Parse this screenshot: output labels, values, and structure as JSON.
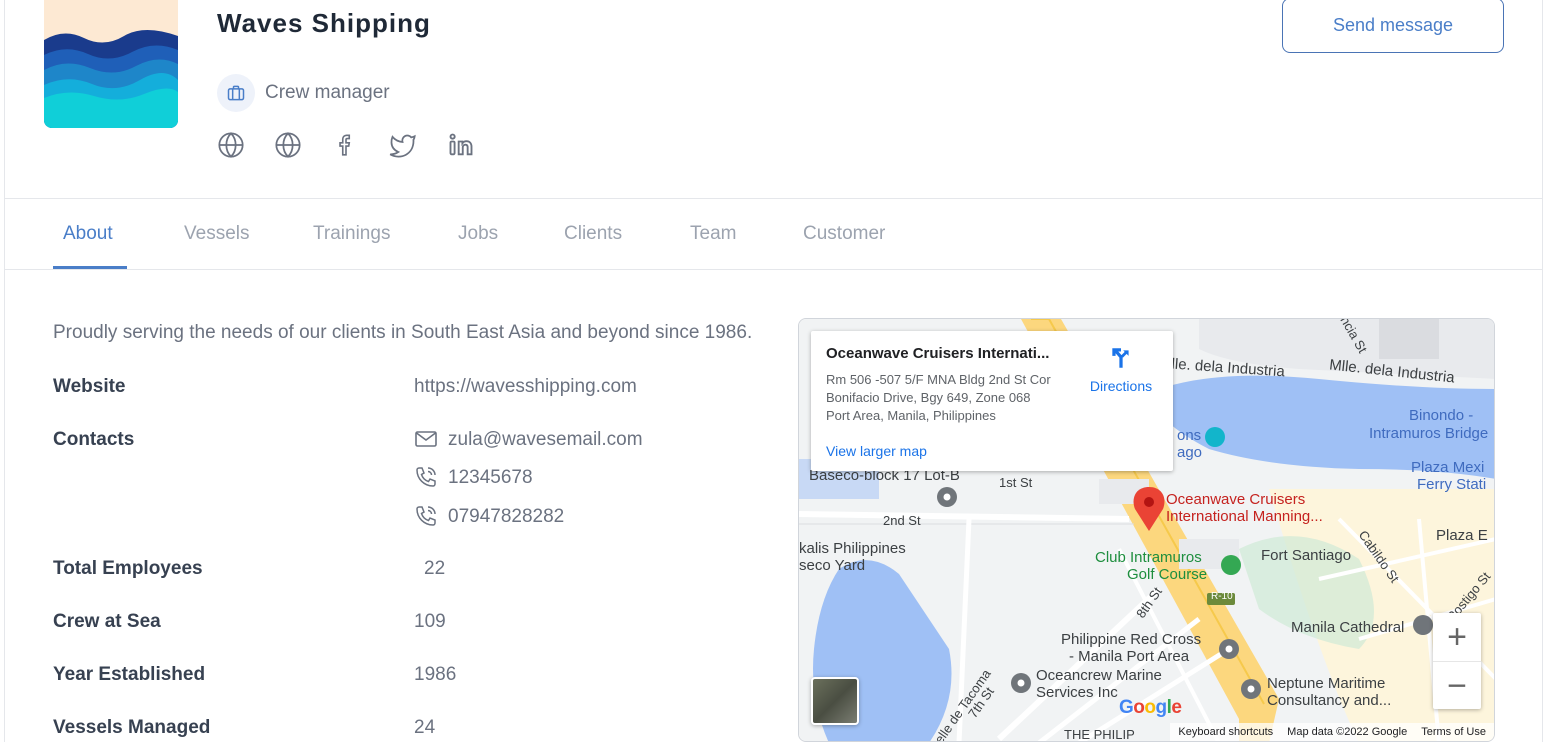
{
  "company": {
    "name": "Waves Shipping",
    "role": "Crew manager",
    "send_message_label": "Send message"
  },
  "social_icons": [
    "globe-icon",
    "globe-icon",
    "facebook-icon",
    "twitter-icon",
    "linkedin-icon"
  ],
  "tabs": [
    {
      "label": "About",
      "active": true
    },
    {
      "label": "Vessels"
    },
    {
      "label": "Trainings"
    },
    {
      "label": "Jobs"
    },
    {
      "label": "Clients"
    },
    {
      "label": "Team"
    },
    {
      "label": "Customer"
    }
  ],
  "about": {
    "tagline": "Proudly serving the needs of our clients in South East Asia and beyond since 1986.",
    "website_label": "Website",
    "website": "https://wavesshipping.com",
    "contacts_label": "Contacts",
    "email": "zula@wavesemail.com",
    "phone1": "12345678",
    "phone2": "07947828282",
    "total_employees_label": "Total Employees",
    "total_employees": "22",
    "crew_at_sea_label": "Crew at Sea",
    "crew_at_sea": "109",
    "year_established_label": "Year Established",
    "year_established": "1986",
    "vessels_managed_label": "Vessels Managed",
    "vessels_managed": "24"
  },
  "map": {
    "card_title": "Oceanwave Cruisers Internati...",
    "card_address": "Rm 506 -507 5/F MNA Bldg 2nd St Cor Bonifacio Drive, Bgy 649, Zone 068 Port Area, Manila, Philippines",
    "directions_label": "Directions",
    "view_larger": "View larger map",
    "labels": {
      "industria1": "Mlle. dela Industria",
      "industria2": "Mlle. dela Industria",
      "binondo": "Binondo -",
      "intramuros_bridge": "Intramuros Bridge",
      "plaza_mexico": "Plaza Mexi",
      "ferry": "Ferry Stati",
      "baseco": "Baseco-block 17 Lot-B",
      "first_st": "1st St",
      "second_st": "2nd St",
      "pin_label1": "Oceanwave Cruisers",
      "pin_label2": "International Manning...",
      "kalis": "kalis Philippines",
      "seco_yard": "seco Yard",
      "club1": "Club Intramuros",
      "club2": "Golf Course",
      "fort": "Fort Santiago",
      "plaza_e": "Plaza E",
      "cabildo": "Cabildo St",
      "postigo": "Postigo St",
      "eighth": "8th St",
      "redcross1": "Philippine Red Cross",
      "redcross2": "- Manila Port Area",
      "cathedral": "Manila Cathedral",
      "oceancrew1": "Oceancrew Marine",
      "oceancrew2": "Services Inc",
      "neptune1": "Neptune Maritime",
      "neptune2": "Consultancy and...",
      "tacoma": "elle de Tacoma",
      "seventh": "7th St",
      "the_phil": "THE PHILIP",
      "cia_st": "ncia St",
      "r10": "R-10",
      "ons": "ons",
      "ago": "ago"
    },
    "google": "Google",
    "footer": {
      "shortcuts": "Keyboard shortcuts",
      "data": "Map data ©2022 Google",
      "terms": "Terms of Use"
    },
    "zoom_in": "+",
    "zoom_out": "−"
  }
}
